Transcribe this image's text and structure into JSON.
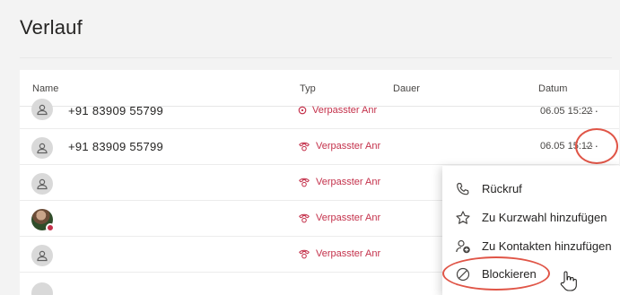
{
  "page": {
    "title": "Verlauf"
  },
  "table": {
    "columns": {
      "name": "Name",
      "type": "Typ",
      "duration": "Dauer",
      "date": "Datum"
    },
    "rows": [
      {
        "name": "+91 83909 55799",
        "type": "Verpasster Anr",
        "date": "06.05 15:22",
        "more": "···"
      },
      {
        "name": "+91 83909 55799",
        "type": "Verpasster Anr",
        "date": "06.05 15:12",
        "more": "···"
      },
      {
        "name": "",
        "type": "Verpasster Anr"
      },
      {
        "name": "",
        "type": "Verpasster Anr"
      },
      {
        "name": "",
        "type": "Verpasster Anr"
      }
    ]
  },
  "context_menu": {
    "items": [
      {
        "label": "Rückruf",
        "icon": "phone-icon"
      },
      {
        "label": "Zu Kurzwahl hinzufügen",
        "icon": "star-icon"
      },
      {
        "label": "Zu Kontakten hinzufügen",
        "icon": "add-contact-icon"
      },
      {
        "label": "Blockieren",
        "icon": "block-icon"
      }
    ]
  },
  "colors": {
    "missed": "#c4314b",
    "highlight_ring": "#e05547"
  }
}
